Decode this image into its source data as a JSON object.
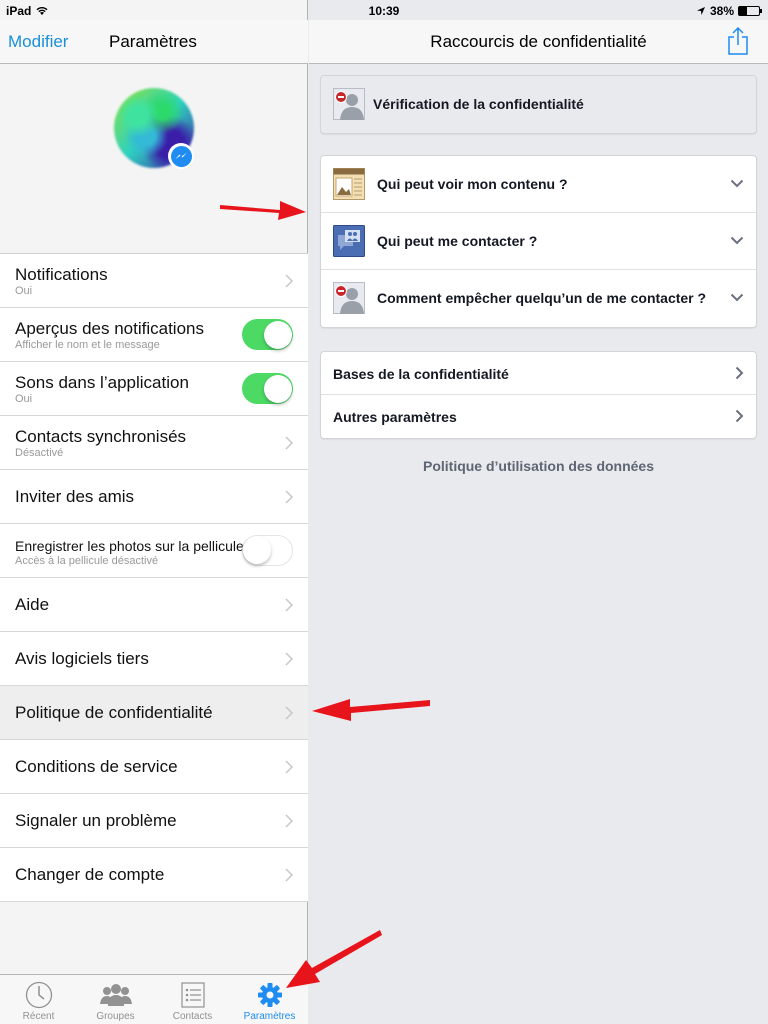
{
  "status_bar": {
    "device": "iPad",
    "time": "10:39",
    "battery": "38%",
    "battery_level": 0.38
  },
  "left_panel": {
    "nav": {
      "edit_label": "Modifier",
      "title": "Paramètres"
    },
    "settings": [
      {
        "label": "Notifications",
        "sublabel": "Oui",
        "type": "chevron"
      },
      {
        "label": "Aperçus des notifications",
        "sublabel": "Afficher le nom et le message",
        "type": "toggle",
        "value": true
      },
      {
        "label": "Sons dans l’application",
        "sublabel": "Oui",
        "type": "toggle",
        "value": true
      },
      {
        "label": "Contacts synchronisés",
        "sublabel": "Désactivé",
        "type": "chevron"
      },
      {
        "label": "Inviter des amis",
        "type": "chevron"
      },
      {
        "label": "Enregistrer les photos sur la pellicule",
        "sublabel": "Accès à la pellicule désactivé",
        "type": "toggle",
        "value": false
      },
      {
        "label": "Aide",
        "type": "chevron"
      },
      {
        "label": "Avis logiciels tiers",
        "type": "chevron"
      },
      {
        "label": "Politique de confidentialité",
        "type": "chevron",
        "selected": true
      },
      {
        "label": "Conditions de service",
        "type": "chevron"
      },
      {
        "label": "Signaler un problème",
        "type": "chevron"
      },
      {
        "label": "Changer de compte",
        "type": "chevron"
      }
    ],
    "tabs": [
      {
        "label": "Récent",
        "icon": "clock-icon"
      },
      {
        "label": "Groupes",
        "icon": "groups-icon"
      },
      {
        "label": "Contacts",
        "icon": "contacts-list-icon"
      },
      {
        "label": "Paramètres",
        "icon": "gear-icon",
        "active": true
      }
    ]
  },
  "right_panel": {
    "nav": {
      "title": "Raccourcis de confidentialité"
    },
    "privacy_checkup": {
      "label": "Vérification de la confidentialité",
      "icon": "blocked-user-icon"
    },
    "shortcuts": [
      {
        "label": "Qui peut voir mon contenu ?",
        "icon": "content-icon"
      },
      {
        "label": "Qui peut me contacter ?",
        "icon": "contact-messages-icon"
      },
      {
        "label": "Comment empêcher quelqu’un de me contacter ?",
        "icon": "blocked-user-icon"
      }
    ],
    "links": [
      {
        "label": "Bases de la confidentialité"
      },
      {
        "label": "Autres paramètres"
      }
    ],
    "footer_link": "Politique d’utilisation des données"
  },
  "colors": {
    "accent": "#1e8cf1",
    "toggle_on": "#4cd964",
    "annotation_arrow": "#e8141b"
  }
}
